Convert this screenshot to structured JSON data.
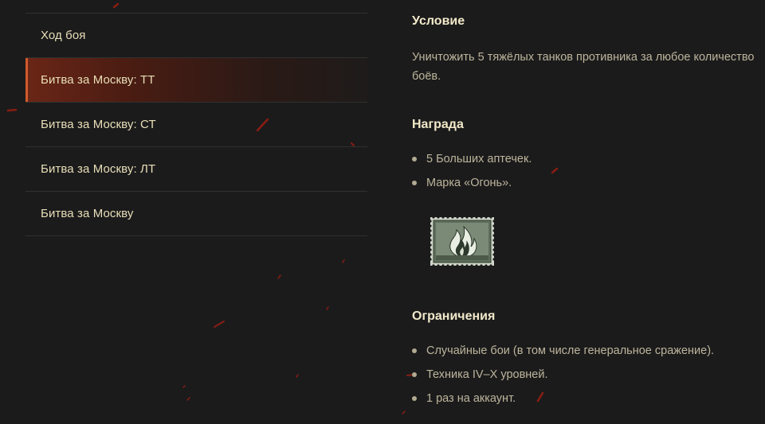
{
  "tabs": [
    {
      "label": "Ход боя",
      "active": false
    },
    {
      "label": "Битва за Москву: ТТ",
      "active": true
    },
    {
      "label": "Битва за Москву: СТ",
      "active": false
    },
    {
      "label": "Битва за Москву: ЛТ",
      "active": false
    },
    {
      "label": "Битва за Москву",
      "active": false
    }
  ],
  "condition": {
    "title": "Условие",
    "text": "Уничтожить 5 тяжёлых танков противника за любое количество боёв."
  },
  "reward": {
    "title": "Награда",
    "items": [
      "5 Больших аптечек.",
      "Марка «Огонь»."
    ],
    "stamp_icon": "fire-stamp-icon"
  },
  "restrictions": {
    "title": "Ограничения",
    "items": [
      "Случайные бои (в том числе генеральное сражение).",
      "Техника IV–X уровней.",
      "1 раз на аккаунт."
    ]
  },
  "colors": {
    "background": "#1b1b1c",
    "accent": "#d05a2c",
    "title": "#f1e9c9",
    "text": "#bdb59b",
    "tab_text": "#e9dfb8"
  }
}
